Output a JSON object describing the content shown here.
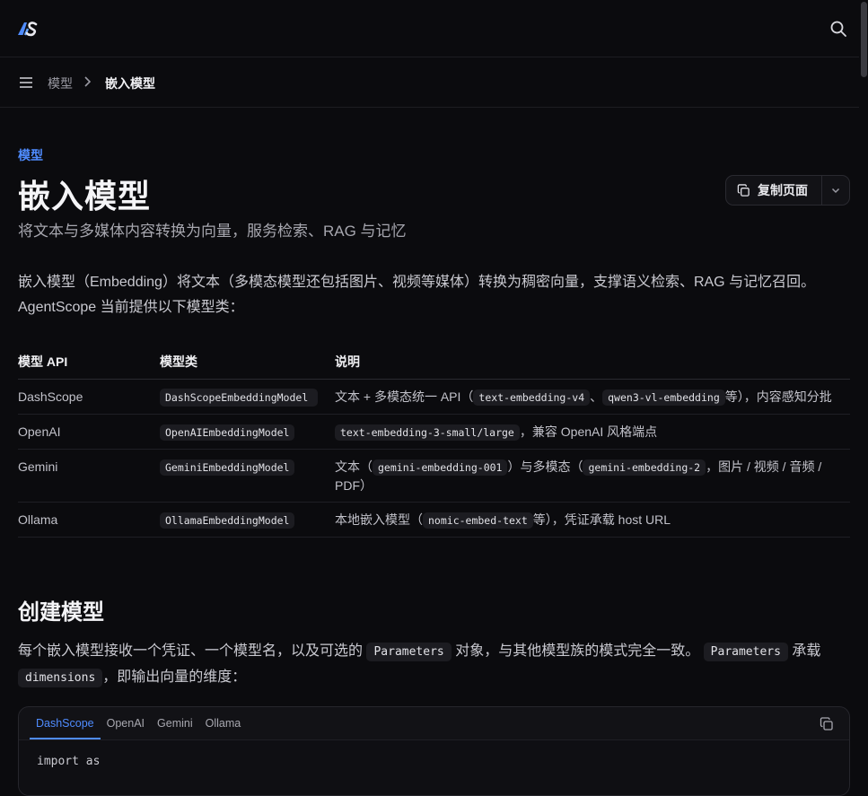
{
  "header": {
    "logo_text": "AS"
  },
  "breadcrumb": {
    "parent": "模型",
    "current": "嵌入模型"
  },
  "page": {
    "eyebrow": "模型",
    "title": "嵌入模型",
    "subtitle": "将文本与多媒体内容转换为向量，服务检索、RAG 与记忆",
    "copy_label": "复制页面",
    "intro": "嵌入模型（Embedding）将文本（多模态模型还包括图片、视频等媒体）转换为稠密向量，支撑语义检索、RAG 与记忆召回。AgentScope 当前提供以下模型类："
  },
  "table": {
    "headers": [
      "模型 API",
      "模型类",
      "说明"
    ],
    "rows": [
      {
        "api": "DashScope",
        "class": "DashScopeEmbeddingModel",
        "desc_a": "文本 + 多模态统一 API（",
        "code_a": "text-embedding-v4",
        "desc_b": "、",
        "code_b": "qwen3-vl-embedding",
        "desc_c": "等），内容感知分批"
      },
      {
        "api": "OpenAI",
        "class": "OpenAIEmbeddingModel",
        "code_a": "text-embedding-3-small/large",
        "desc_a": "，兼容 OpenAI 风格端点"
      },
      {
        "api": "Gemini",
        "class": "GeminiEmbeddingModel",
        "desc_a": "文本（",
        "code_a": "gemini-embedding-001",
        "desc_b": "）与多模态（",
        "code_b": "gemini-embedding-2",
        "desc_c": "，图片 / 视频 / 音频 / PDF）"
      },
      {
        "api": "Ollama",
        "class": "OllamaEmbeddingModel",
        "desc_a": "本地嵌入模型（",
        "code_a": "nomic-embed-text",
        "desc_b": "等），凭证承载 host URL"
      }
    ]
  },
  "section": {
    "heading": "创建模型",
    "p_a": "每个嵌入模型接收一个凭证、一个模型名，以及可选的",
    "code_a": "Parameters",
    "p_b": "对象，与其他模型族的模式完全一致。",
    "code_b": "Parameters",
    "p_c": "承载",
    "code_c": "dimensions",
    "p_d": "，即输出向量的维度："
  },
  "code_tabs": [
    "DashScope",
    "OpenAI",
    "Gemini",
    "Ollama"
  ],
  "code_first_line": "import as",
  "colors": {
    "accent": "#4f8cff",
    "background": "#0b0b0e"
  }
}
